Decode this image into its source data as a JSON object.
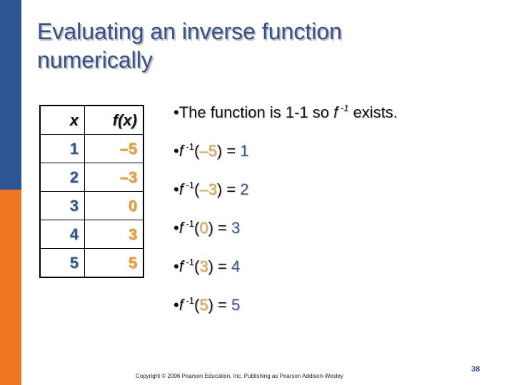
{
  "slide": {
    "title_line1": "Evaluating an inverse function",
    "title_line2": "numerically",
    "page_number": "38",
    "copyright": "Copyright © 2006 Pearson Education, Inc.  Publishing as Pearson Addison-Wesley",
    "colors": {
      "blue": "#2e5594",
      "orange": "#f07823",
      "value_orange": "#f39c1e"
    }
  },
  "table": {
    "headers": [
      "x",
      "f(x)"
    ],
    "rows": [
      {
        "x": "1",
        "fx": "–5"
      },
      {
        "x": "2",
        "fx": "–3"
      },
      {
        "x": "3",
        "fx": "0"
      },
      {
        "x": "4",
        "fx": "3"
      },
      {
        "x": "5",
        "fx": "5"
      }
    ]
  },
  "bullets": {
    "intro": {
      "bullet": "•",
      "text_before": "The function is 1-1 so ",
      "f": "f",
      "sup": " -1",
      "text_after": " exists."
    },
    "evaluations": [
      {
        "bullet": "•",
        "f": "f",
        "sup": " -1",
        "open": "(",
        "input": "–5",
        "close": ") = ",
        "output": "1"
      },
      {
        "bullet": "•",
        "f": "f",
        "sup": " -1",
        "open": "(",
        "input": "–3",
        "close": ") = ",
        "output": "2"
      },
      {
        "bullet": "•",
        "f": "f",
        "sup": " -1",
        "open": "(",
        "input": "0",
        "close": ") = ",
        "output": "3"
      },
      {
        "bullet": "•",
        "f": "f",
        "sup": " -1",
        "open": "(",
        "input": "3",
        "close": ") = ",
        "output": "4"
      },
      {
        "bullet": "•",
        "f": "f",
        "sup": " -1",
        "open": "(",
        "input": "5",
        "close": ") = ",
        "output": "5"
      }
    ]
  }
}
